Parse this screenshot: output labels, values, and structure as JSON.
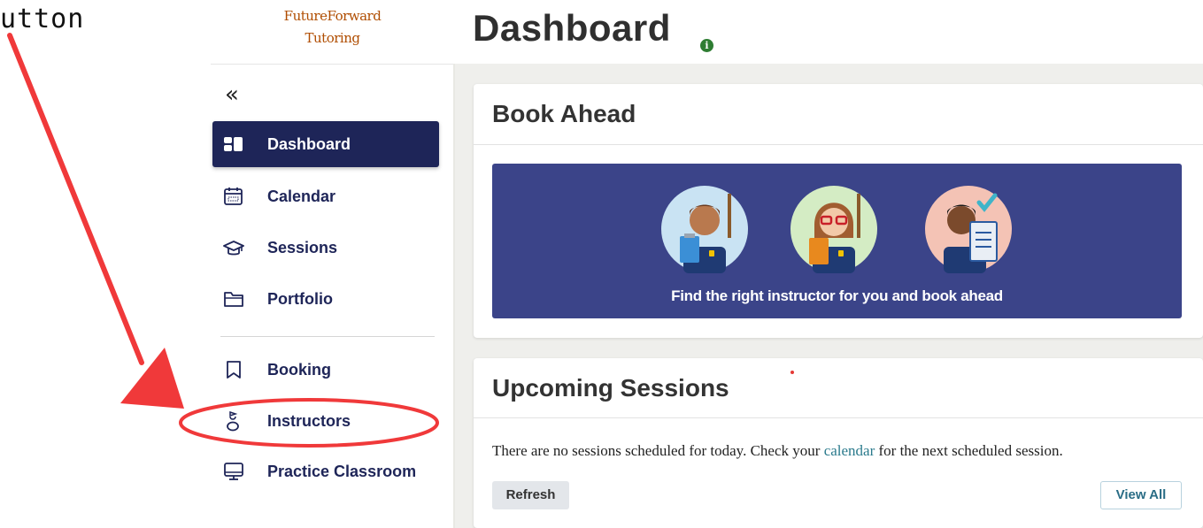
{
  "annotation": {
    "text": "utton"
  },
  "brand": {
    "line1": "FutureForward",
    "line2": "Tutoring"
  },
  "sidebar": {
    "collapse_icon": "«",
    "items": [
      {
        "label": "Dashboard",
        "icon": "dashboard-icon",
        "active": true
      },
      {
        "label": "Calendar",
        "icon": "calendar-icon"
      },
      {
        "label": "Sessions",
        "icon": "graduation-cap-icon"
      },
      {
        "label": "Portfolio",
        "icon": "folder-icon"
      },
      {
        "label": "Booking",
        "icon": "bookmark-icon"
      },
      {
        "label": "Instructors",
        "icon": "instructor-icon"
      },
      {
        "label": "Practice Classroom",
        "icon": "monitor-icon"
      }
    ]
  },
  "header": {
    "title": "Dashboard",
    "info_icon": "i"
  },
  "book_ahead": {
    "title": "Book Ahead",
    "banner_caption": "Find the right instructor for you and book ahead"
  },
  "upcoming": {
    "title": "Upcoming Sessions",
    "message_before": "There are no sessions scheduled for today. Check your ",
    "message_link": "calendar",
    "message_after": " for the next scheduled session.",
    "refresh_label": "Refresh",
    "view_all_label": "View All"
  },
  "colors": {
    "nav_active": "#1e2558",
    "banner": "#3b4489",
    "annotation_red": "#f0393a",
    "brand": "#b04d00"
  }
}
